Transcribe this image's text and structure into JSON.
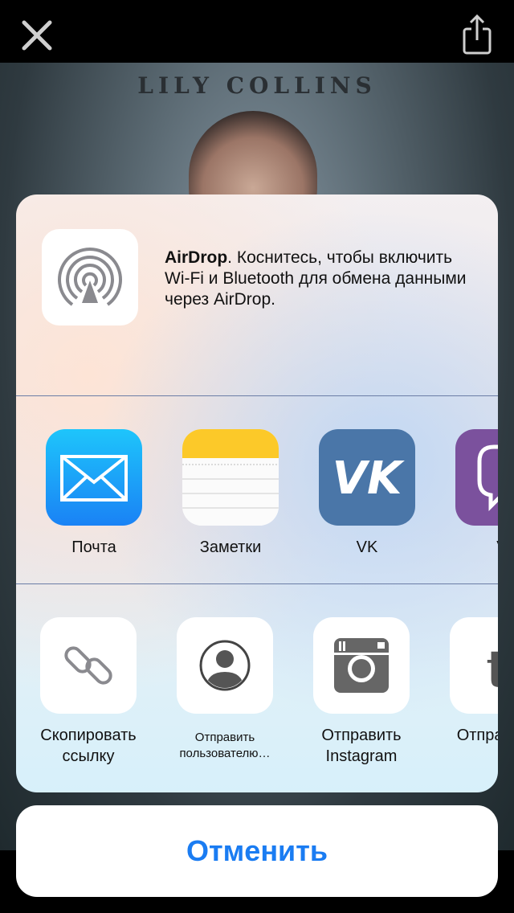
{
  "background": {
    "cover_author": "LILY COLLINS"
  },
  "airdrop": {
    "title": "AirDrop",
    "description": ". Коснитесь, чтобы включить Wi-Fi и Bluetooth для обмена данными через AirDrop."
  },
  "apps": [
    {
      "label": "Почта",
      "icon": "mail-icon",
      "color": "#1aa3f7"
    },
    {
      "label": "Заметки",
      "icon": "notes-icon",
      "color": "#fecf2c"
    },
    {
      "label": "VK",
      "icon": "vk-icon",
      "color": "#4a76a8"
    },
    {
      "label": "Vi",
      "icon": "viber-icon",
      "color": "#7b519d"
    }
  ],
  "actions": [
    {
      "label": "Скопировать ссылку",
      "icon": "link-icon"
    },
    {
      "label": "Отправить пользователю…",
      "icon": "person-icon"
    },
    {
      "label": "Отправить Instagram",
      "icon": "instagram-icon"
    },
    {
      "label": "Отпра Tum",
      "icon": "tumblr-icon"
    }
  ],
  "cancel_label": "Отменить",
  "colors": {
    "accent": "#1a7cf2",
    "divider": "#6b7da6"
  }
}
